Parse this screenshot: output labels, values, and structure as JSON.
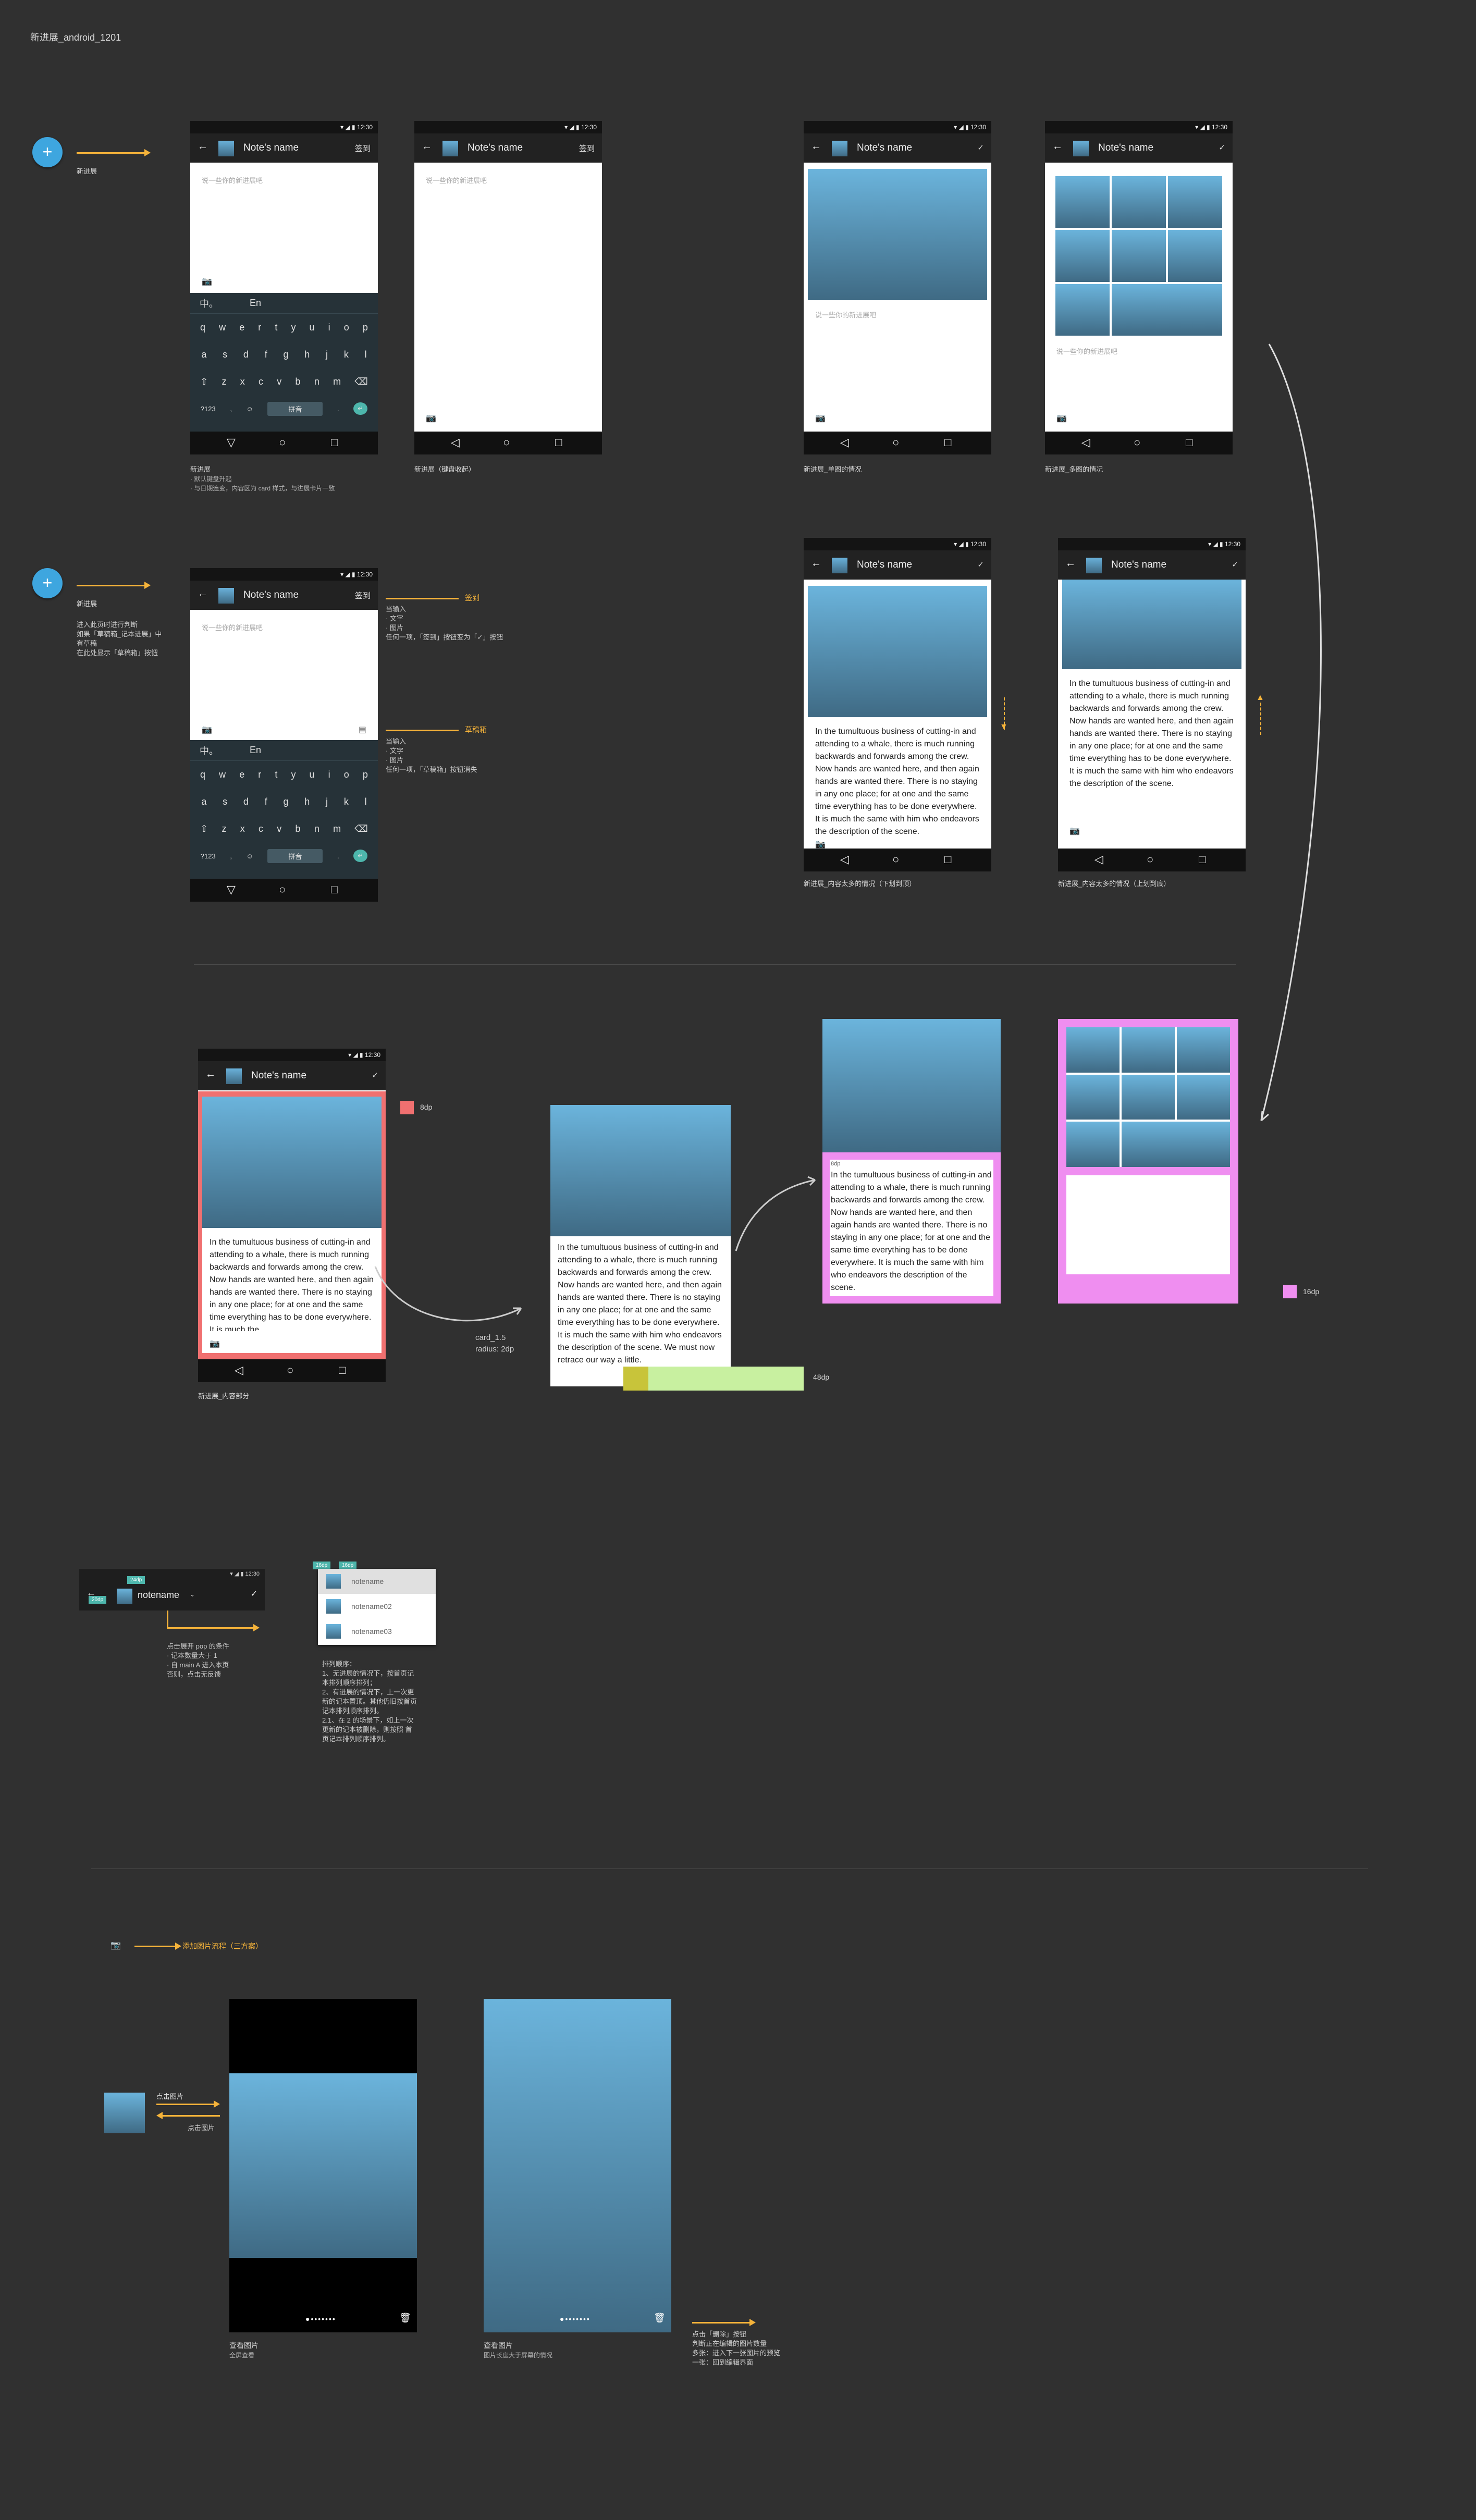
{
  "header": {
    "title": "新进展_android_1201"
  },
  "note_name": "Note's name",
  "status_time": "12:30",
  "action_save": "签到",
  "placeholder": "说一些你的新进展吧",
  "keyboard": {
    "lang": [
      "中。",
      "En"
    ],
    "row1": [
      "q",
      "w",
      "e",
      "r",
      "t",
      "y",
      "u",
      "i",
      "o",
      "p"
    ],
    "row2": [
      "a",
      "s",
      "d",
      "f",
      "g",
      "h",
      "j",
      "k",
      "l"
    ],
    "row3": [
      "z",
      "x",
      "c",
      "v",
      "b",
      "n",
      "m"
    ],
    "num": "?123",
    "space": "拼音"
  },
  "body_text": "In the tumultuous business of cutting-in and attending to a whale, there is much running backwards and forwards among the crew. Now hands are wanted here, and then again hands are wanted there. There is no staying in any one place; for at one and the same time everything has to be done everywhere. It is much the same with him who endeavors the description of the scene.",
  "body_text_cut": "In the tumultuous business of cutting-in and attending to a whale, there is much running backwards and forwards among the crew. Now hands are wanted here, and then again hands are wanted there. There is no staying in any one place; for at one and the same time everything has to be done everywhere. It is much the",
  "body_text_more": "In the tumultuous business of cutting-in and attending to a whale, there is much running backwards and forwards among the crew. Now hands are wanted here, and then again hands are wanted there. There is no staying in any one place; for at one and the same time everything has to be done everywhere. It is much the same with him who endeavors the description of the scene. We must now retrace our way a little.",
  "row1": {
    "fab_label": "新进展",
    "s1_caption": "新进展",
    "s1_notes": "· 默认键盘升起\n· 与日期连变，内容区为 card 样式，与进展卡片一致",
    "s2_caption": "新进展（键盘收起）",
    "s3_caption": "新进展_单图的情况",
    "s4_caption": "新进展_多图的情况"
  },
  "row2": {
    "fab_label": "新进展",
    "fab_notes": "进入此页时进行判断\n如果「草稿箱_记本进展」中\n有草稿\n在此处显示「草稿箱」按钮",
    "ann1_tag": "签到",
    "ann1_text": "当输入\n· 文字\n· 图片\n任何一项，「签到」按钮变为「✓」按钮",
    "ann2_tag": "草稿箱",
    "ann2_text": "当输入\n· 文字\n· 图片\n任何一项，「草稿箱」按钮消失",
    "s5_caption": "新进展_内容太多的情况（下划到顶）",
    "s6_caption": "新进展_内容太多的情况（上划到底）"
  },
  "row3": {
    "s7_caption": "新进展_内容部分",
    "pad_label": "8dp",
    "card_label": "card_1.5\nradius: 2dp",
    "bar_label": "48dp",
    "pink_label": "16dp",
    "small_label": "8dp"
  },
  "row4": {
    "dropdown_name": "notename",
    "items": [
      "notename",
      "notename02",
      "notename03"
    ],
    "tag1": "24dp",
    "tag2": "20dp",
    "tag3": "16dp",
    "tag4": "16dp",
    "pop_notes": "点击展开 pop 的条件\n· 记本数量大于 1\n· 自 main A 进入本页\n否则，点击无反馈",
    "sort_notes": "排列顺序：\n1、无进展的情况下，按首页记\n本排列顺序排列；\n2、有进展的情况下，上一次更\n新的记本置顶。其他仍旧按首页\n记本排列顺序排列。\n2.1、在 2 的场景下，如上一次\n更新的记本被删除，则按照 首\n页记本排列顺序排列。"
  },
  "row5": {
    "flow_title": "添加图片流程（三方案）",
    "click_img": "点击图片",
    "click_img2": "点击图片",
    "view1_caption": "查看图片",
    "view1_sub": "全屏查看",
    "view2_caption": "查看图片",
    "view2_sub": "图片长度大于屏幕的情况",
    "delete_notes": "点击「删除」按钮\n判断正在编辑的图片数量\n多张：进入下一张图片的预览\n一张：回到编辑界面"
  },
  "colors": {
    "background": "#303030",
    "accent": "#f5b33a",
    "fab": "#3ea6df",
    "pink": "#ef8ef0",
    "red": "#f07070",
    "green": "#c8f0a0"
  }
}
